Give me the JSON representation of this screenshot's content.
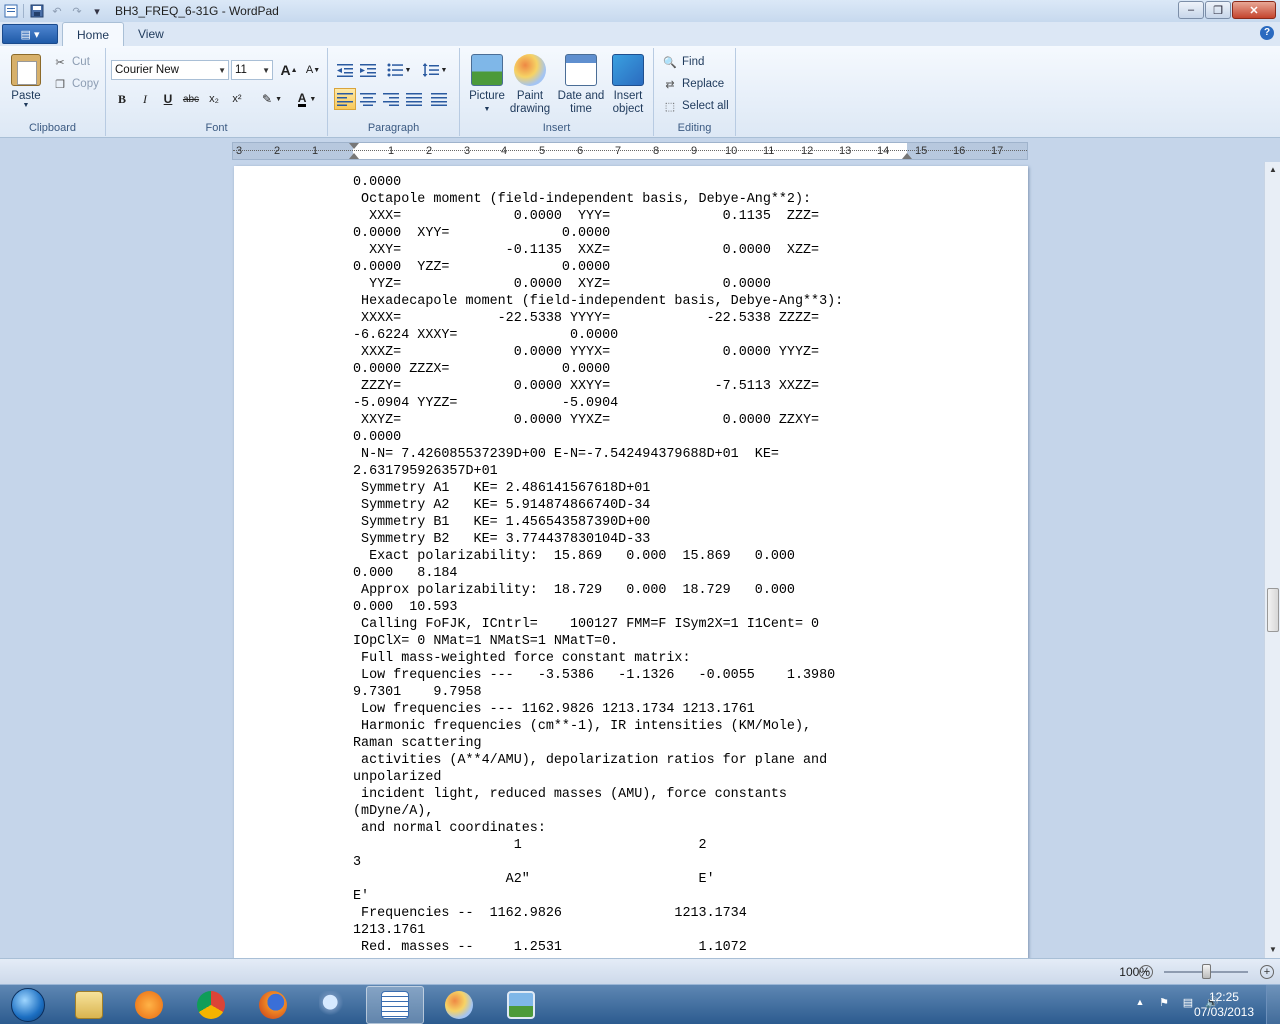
{
  "window": {
    "title": "BH3_FREQ_6-31G - WordPad",
    "minimize": "–",
    "maximize": "❐",
    "close": "✕"
  },
  "qat": {
    "save": "💾",
    "undo": "↶",
    "redo": "↷",
    "customize": "▾"
  },
  "tabs": {
    "app_menu": "▤ ▾",
    "home": "Home",
    "view": "View",
    "help": "?"
  },
  "clipboard": {
    "paste": "Paste",
    "cut": "Cut",
    "copy": "Copy",
    "label": "Clipboard"
  },
  "font": {
    "family": "Courier New",
    "size": "11",
    "grow": "A",
    "shrink": "A",
    "bold": "B",
    "italic": "I",
    "underline": "U",
    "strike": "abc",
    "subscript": "x₂",
    "superscript": "x²",
    "highlight": "✎",
    "color": "A",
    "label": "Font"
  },
  "paragraph": {
    "label": "Paragraph"
  },
  "insert": {
    "picture": "Picture",
    "paint": [
      "Paint",
      "drawing"
    ],
    "datetime": [
      "Date and",
      "time"
    ],
    "object": [
      "Insert",
      "object"
    ],
    "label": "Insert"
  },
  "editing": {
    "find": "Find",
    "replace": "Replace",
    "select_all": "Select all",
    "label": "Editing"
  },
  "ruler": {
    "labels": [
      "3",
      "2",
      "1",
      "1",
      "2",
      "3",
      "4",
      "5",
      "6",
      "7",
      "8",
      "9",
      "10",
      "11",
      "12",
      "13",
      "14",
      "15",
      "16",
      "17"
    ]
  },
  "document": {
    "lines": [
      "0.0000",
      " Octapole moment (field-independent basis, Debye-Ang**2):",
      "  XXX=              0.0000  YYY=              0.1135  ZZZ=",
      "0.0000  XYY=              0.0000",
      "  XXY=             -0.1135  XXZ=              0.0000  XZZ=",
      "0.0000  YZZ=              0.0000",
      "  YYZ=              0.0000  XYZ=              0.0000",
      " Hexadecapole moment (field-independent basis, Debye-Ang**3):",
      " XXXX=            -22.5338 YYYY=            -22.5338 ZZZZ=",
      "-6.6224 XXXY=              0.0000",
      " XXXZ=              0.0000 YYYX=              0.0000 YYYZ=",
      "0.0000 ZZZX=              0.0000",
      " ZZZY=              0.0000 XXYY=             -7.5113 XXZZ=",
      "-5.0904 YYZZ=             -5.0904",
      " XXYZ=              0.0000 YYXZ=              0.0000 ZZXY=",
      "0.0000",
      " N-N= 7.426085537239D+00 E-N=-7.542494379688D+01  KE=",
      "2.631795926357D+01",
      " Symmetry A1   KE= 2.486141567618D+01",
      " Symmetry A2   KE= 5.914874866740D-34",
      " Symmetry B1   KE= 1.456543587390D+00",
      " Symmetry B2   KE= 3.774437830104D-33",
      "  Exact polarizability:  15.869   0.000  15.869   0.000",
      "0.000   8.184",
      " Approx polarizability:  18.729   0.000  18.729   0.000",
      "0.000  10.593",
      " Calling FoFJK, ICntrl=    100127 FMM=F ISym2X=1 I1Cent= 0",
      "IOpClX= 0 NMat=1 NMatS=1 NMatT=0.",
      " Full mass-weighted force constant matrix:",
      " Low frequencies ---   -3.5386   -1.1326   -0.0055    1.3980",
      "9.7301    9.7958",
      " Low frequencies --- 1162.9826 1213.1734 1213.1761",
      " Harmonic frequencies (cm**-1), IR intensities (KM/Mole),",
      "Raman scattering",
      " activities (A**4/AMU), depolarization ratios for plane and",
      "unpolarized",
      " incident light, reduced masses (AMU), force constants",
      "(mDyne/A),",
      " and normal coordinates:",
      "                    1                      2",
      "3",
      "                   A2\"                     E'",
      "E'",
      " Frequencies --  1162.9826              1213.1734",
      "1213.1761",
      " Red. masses --     1.2531                 1.1072"
    ]
  },
  "status": {
    "zoom": "100%",
    "zoom_minus": "−",
    "zoom_plus": "+"
  },
  "taskbar": {
    "time": "12:25",
    "date": "07/03/2013",
    "tray_up": "▲"
  },
  "colors": {
    "chrome_bg": "#c5d5ea",
    "ribbon_bg": "#f5f9fe",
    "taskbar": "#2c5b8f",
    "selected_button": "#f8c95a"
  }
}
